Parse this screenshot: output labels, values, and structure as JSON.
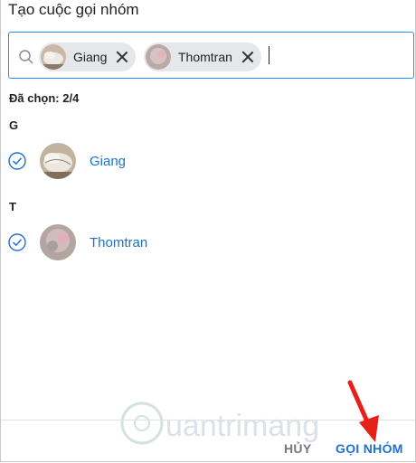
{
  "dialog": {
    "title": "Tạo cuộc gọi nhóm"
  },
  "search": {
    "placeholder": "",
    "chips": [
      {
        "label": "Giang"
      },
      {
        "label": "Thomtran"
      }
    ]
  },
  "selection": {
    "label": "Đã chọn:",
    "count": "2/4",
    "full": "Đã chọn:  2/4"
  },
  "groups": [
    {
      "letter": "G",
      "contacts": [
        {
          "name": "Giang",
          "checked": true
        }
      ]
    },
    {
      "letter": "T",
      "contacts": [
        {
          "name": "Thomtran",
          "checked": true
        }
      ]
    }
  ],
  "footer": {
    "cancel_label": "HỦY",
    "group_call_label": "GỌI NHÓM"
  },
  "colors": {
    "accent": "#1e90ff",
    "link": "#1a73c8",
    "annotation": "#e8201a"
  },
  "watermark": {
    "text": "uantrimang"
  }
}
